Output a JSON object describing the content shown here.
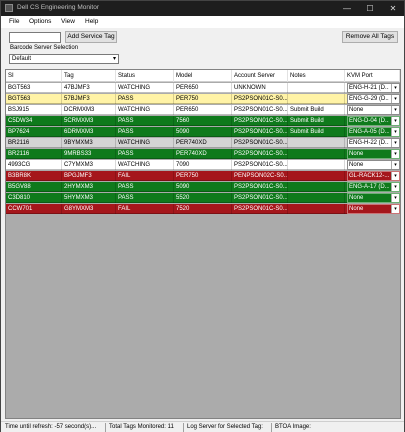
{
  "window": {
    "title": "Dell CS Engineering Monitor",
    "min": "—",
    "max": "☐",
    "close": "✕"
  },
  "menu": [
    "File",
    "Options",
    "View",
    "Help"
  ],
  "toolbar": {
    "tag_input_value": "",
    "add_label": "Add Service Tag",
    "remove_all_label": "Remove All Tags"
  },
  "barcode": {
    "label": "Barcode Server Selection",
    "selected": "Default"
  },
  "grid": {
    "columns": [
      "SI",
      "Tag",
      "Status",
      "Model",
      "Account Server",
      "Notes",
      "KVM Port"
    ],
    "rows": [
      {
        "style": "white",
        "cells": [
          "BGT563",
          "47BJMF3",
          "WATCHING",
          "PER650",
          "UNKNOWN",
          "",
          "ENG-H-21 (D..."
        ]
      },
      {
        "style": "yellow",
        "cells": [
          "BGT563",
          "57BJMF3",
          "PASS",
          "PER750",
          "PS2PSON01C-S0...",
          "",
          "ENG-G-29 (D..."
        ]
      },
      {
        "style": "white",
        "cells": [
          "BSJ915",
          "DCRMXM3",
          "WATCHING",
          "PER650",
          "PS2PSON01C-S0...",
          "Submit Build",
          "None"
        ]
      },
      {
        "style": "green",
        "cells": [
          "C5DW34",
          "5CRMXM3",
          "PASS",
          "7560",
          "PS2PSON01C-S0...",
          "Submit Build",
          "ENG-D-04 (D..."
        ]
      },
      {
        "style": "green",
        "cells": [
          "BP7624",
          "6DRMXM3",
          "PASS",
          "5090",
          "PS2PSON01C-S0...",
          "Submit Build",
          "ENG-A-05 (D..."
        ]
      },
      {
        "style": "gray",
        "cells": [
          "BR2116",
          "9BYMXM3",
          "WATCHING",
          "PER740XD",
          "PS2PSON01C-S0...",
          "",
          "ENG-H-22 (D..."
        ]
      },
      {
        "style": "green",
        "cells": [
          "BR2116",
          "9MRBS33",
          "PASS",
          "PER740XD",
          "PS2PSON01C-S0...",
          "",
          "None"
        ]
      },
      {
        "style": "white",
        "cells": [
          "4993CG",
          "C7YMXM3",
          "WATCHING",
          "7090",
          "PS2PSON01C-S0...",
          "",
          "None"
        ]
      },
      {
        "style": "red",
        "cells": [
          "B3BR8K",
          "BPGJMF3",
          "FAIL",
          "PER750",
          "PENPSON02C-S0...",
          "",
          "GL-RACK12-..."
        ]
      },
      {
        "style": "green",
        "cells": [
          "B5GV88",
          "2HYMXM3",
          "PASS",
          "5090",
          "PS2PSON01C-S0...",
          "",
          "ENG-A-17 (D..."
        ]
      },
      {
        "style": "green",
        "cells": [
          "C3D810",
          "5HYMXM3",
          "PASS",
          "5520",
          "PS2PSON01C-S0...",
          "",
          "None"
        ]
      },
      {
        "style": "red",
        "cells": [
          "CCW701",
          "G8YMXM3",
          "FAIL",
          "7520",
          "PS2PSON01C-S0...",
          "",
          "None"
        ]
      }
    ]
  },
  "status": {
    "refresh": "Time until refresh: -57 second(s)...",
    "total": "Total Tags Monitored: 11",
    "log_server": "Log Server for Selected Tag:",
    "btoa": "BTOA Image:"
  },
  "icons": {
    "dropdown": "chevron-down-icon",
    "app": "app-icon"
  }
}
